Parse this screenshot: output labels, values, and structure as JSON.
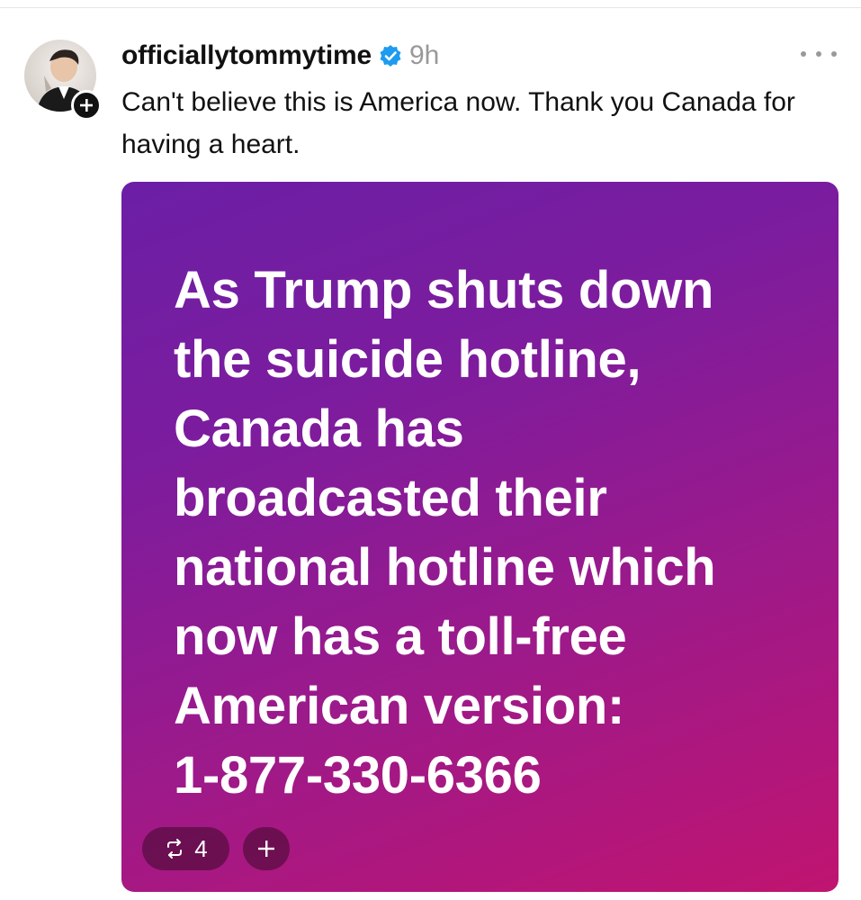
{
  "post": {
    "username": "officiallytommytime",
    "time": "9h",
    "text": "Can't believe this is America now. Thank you Canada for having a heart.",
    "verified_icon": "verified-badge-icon",
    "colors": {
      "verified": "#1d9bf0",
      "time": "#999999"
    }
  },
  "media": {
    "lines": [
      "As Trump shuts down",
      "the suicide hotline,",
      "Canada has",
      "broadcasted their",
      "national hotline which",
      "now has a toll-free",
      "American version:",
      "1-877-330-6366"
    ],
    "gradient": [
      "#6b1fa6",
      "#c01470"
    ]
  },
  "actions": {
    "repost_count": "4",
    "repost_icon": "repost-icon",
    "add_icon": "plus-icon"
  }
}
